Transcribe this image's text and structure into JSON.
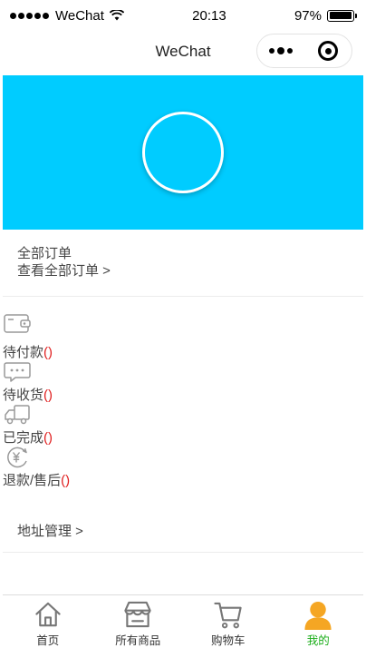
{
  "status_bar": {
    "carrier": "WeChat",
    "time": "20:13",
    "battery": "97%",
    "battery_level": 0.97
  },
  "nav": {
    "title": "WeChat"
  },
  "colors": {
    "banner": "#00ccff",
    "accent_active": "#1aad19",
    "count": "#e02020",
    "active_icon": "#f5a623"
  },
  "orders": {
    "title": "全部订单",
    "view_all": "查看全部订单 >"
  },
  "statuses": [
    {
      "icon": "wallet-icon",
      "label": "待付款",
      "count_open": "(",
      "count_close": ")"
    },
    {
      "icon": "chat-dots-icon",
      "label": "待收货",
      "count_open": "(",
      "count_close": ")"
    },
    {
      "icon": "truck-icon",
      "label": "已完成",
      "count_open": "(",
      "count_close": ")"
    },
    {
      "icon": "yuan-refund-icon",
      "label": "退款/售后",
      "count_open": "(",
      "count_close": ")"
    }
  ],
  "address": {
    "label": "地址管理 >"
  },
  "tabs": [
    {
      "icon": "home-icon",
      "label": "首页"
    },
    {
      "icon": "store-icon",
      "label": "所有商品"
    },
    {
      "icon": "cart-icon",
      "label": "购物车"
    },
    {
      "icon": "user-icon",
      "label": "我的"
    }
  ]
}
